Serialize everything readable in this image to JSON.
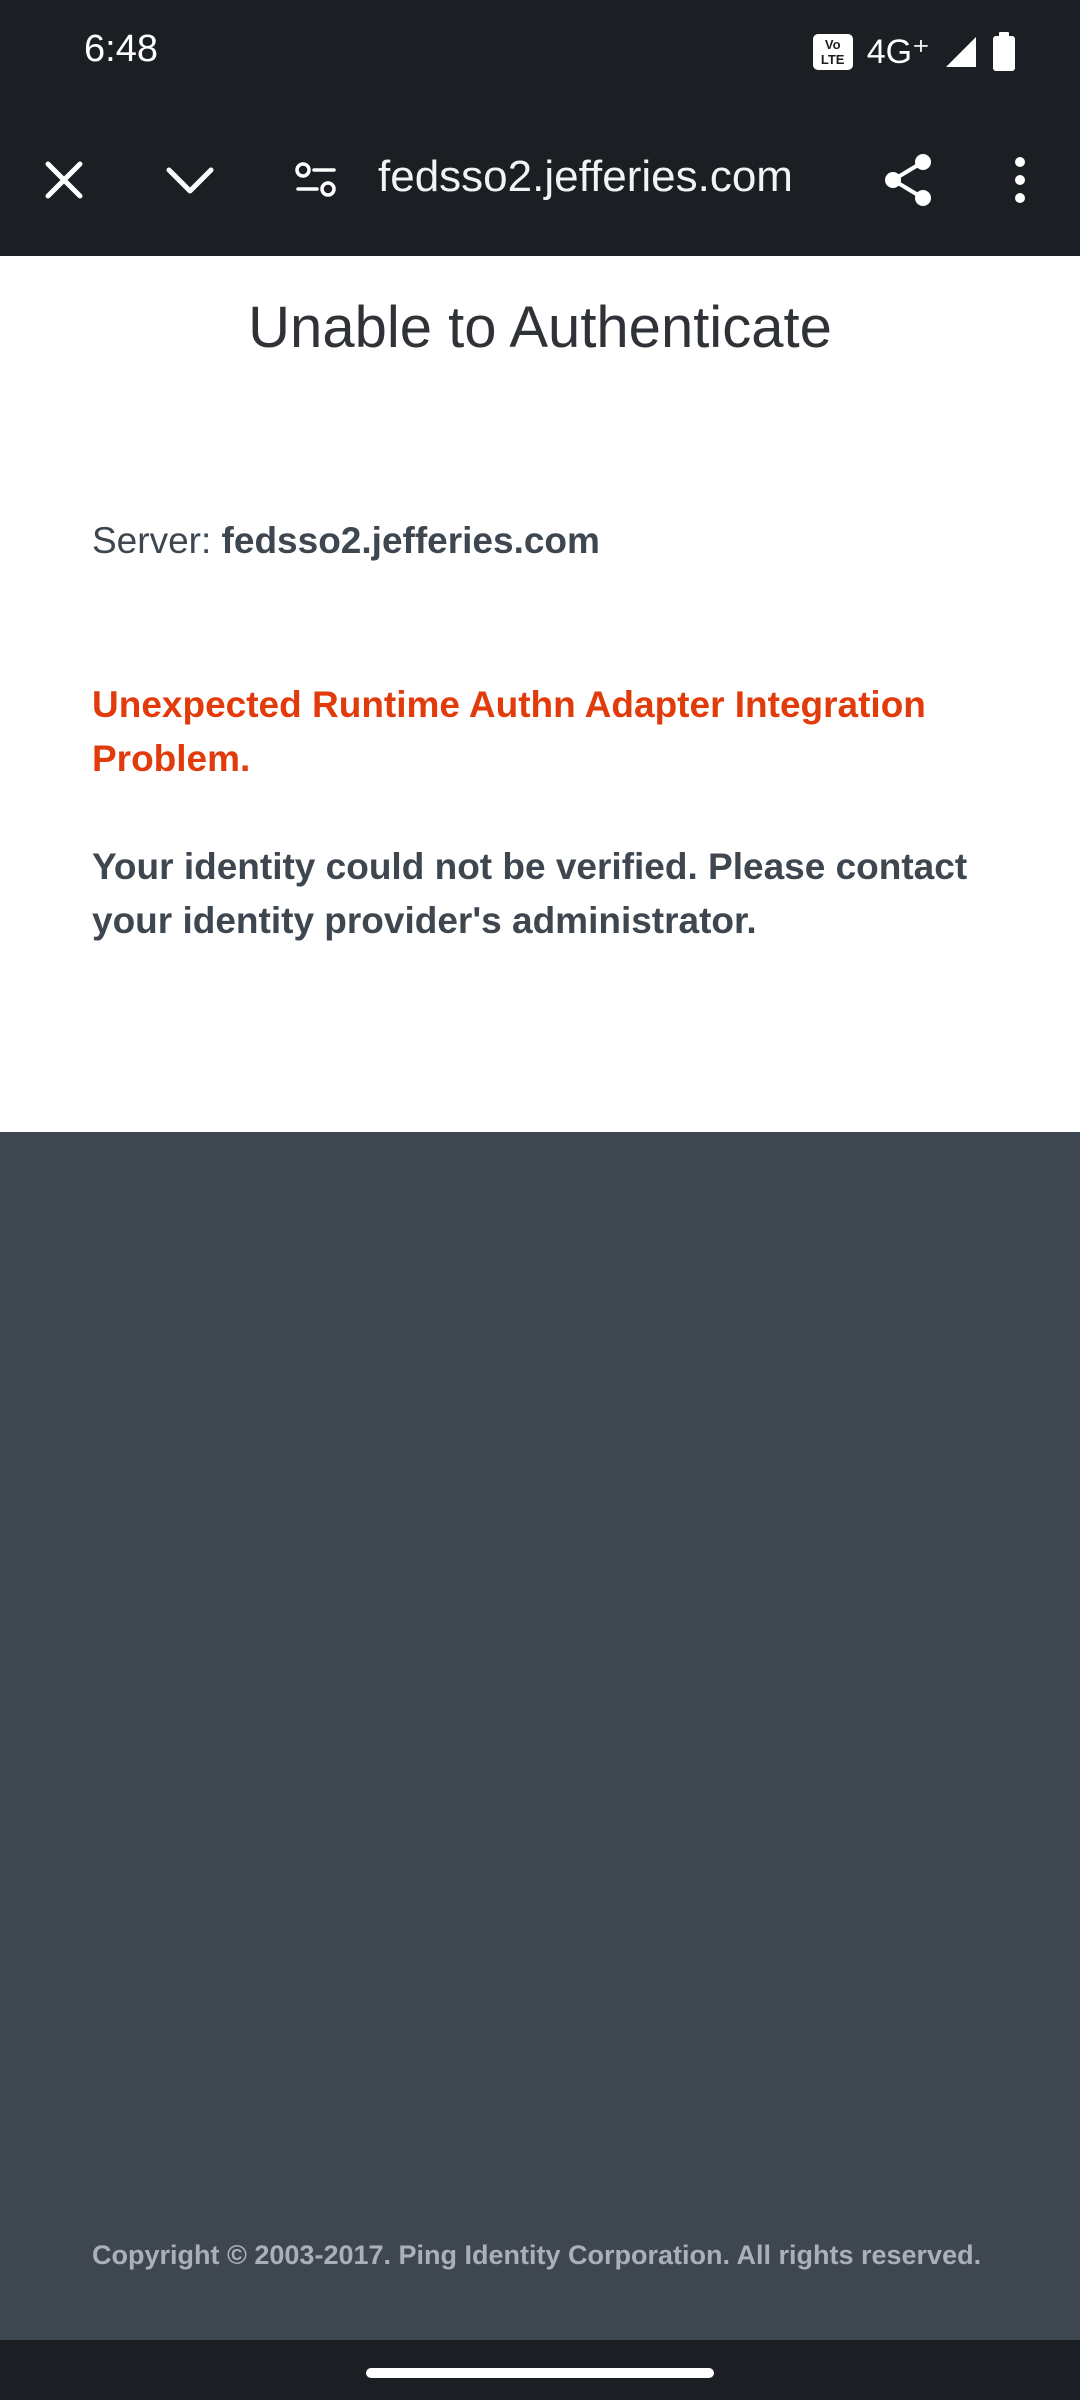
{
  "status_bar": {
    "time": "6:48",
    "volte_label": "Vo\nLTE",
    "network": "4G⁺",
    "icons": [
      "volte-icon",
      "signal-icon",
      "battery-icon"
    ]
  },
  "browser": {
    "url": "fedsso2.jefferies.com",
    "icons": [
      "close-icon",
      "chevron-down-icon",
      "site-settings-icon",
      "share-icon",
      "more-vert-icon"
    ]
  },
  "page": {
    "title": "Unable to Authenticate",
    "server_label": "Server: ",
    "server_value": "fedsso2.jefferies.com",
    "error_message": "Unexpected Runtime Authn Adapter Integration Problem.",
    "info_message": "Your identity could not be verified. Please contact your identity provider's administrator.",
    "footer": "Copyright © 2003-2017. Ping Identity Corporation. All rights reserved."
  },
  "colors": {
    "error": "#e23b0b",
    "text": "#3e464f",
    "footer_bg": "#3e464f",
    "chrome": "#1b1e22"
  }
}
